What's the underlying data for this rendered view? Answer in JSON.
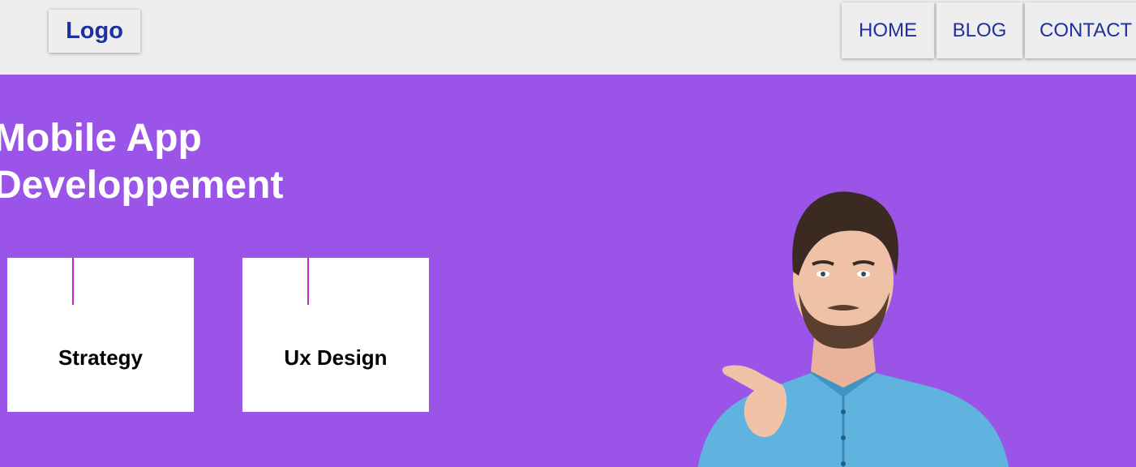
{
  "header": {
    "logo_label": "Logo",
    "nav": [
      {
        "label": "HOME"
      },
      {
        "label": "BLOG"
      },
      {
        "label": "CONTACT"
      }
    ]
  },
  "hero": {
    "title_line1": "Mobile App",
    "title_line2": "Developpement",
    "cards": [
      {
        "label": "Strategy"
      },
      {
        "label": "Ux Design"
      }
    ],
    "image": "person-pointing-photo"
  },
  "colors": {
    "header_bg": "#ededed",
    "brand_text": "#1f30a0",
    "hero_bg": "#9b54e8",
    "card_bg": "#ffffff",
    "card_accent": "#c026c9"
  }
}
